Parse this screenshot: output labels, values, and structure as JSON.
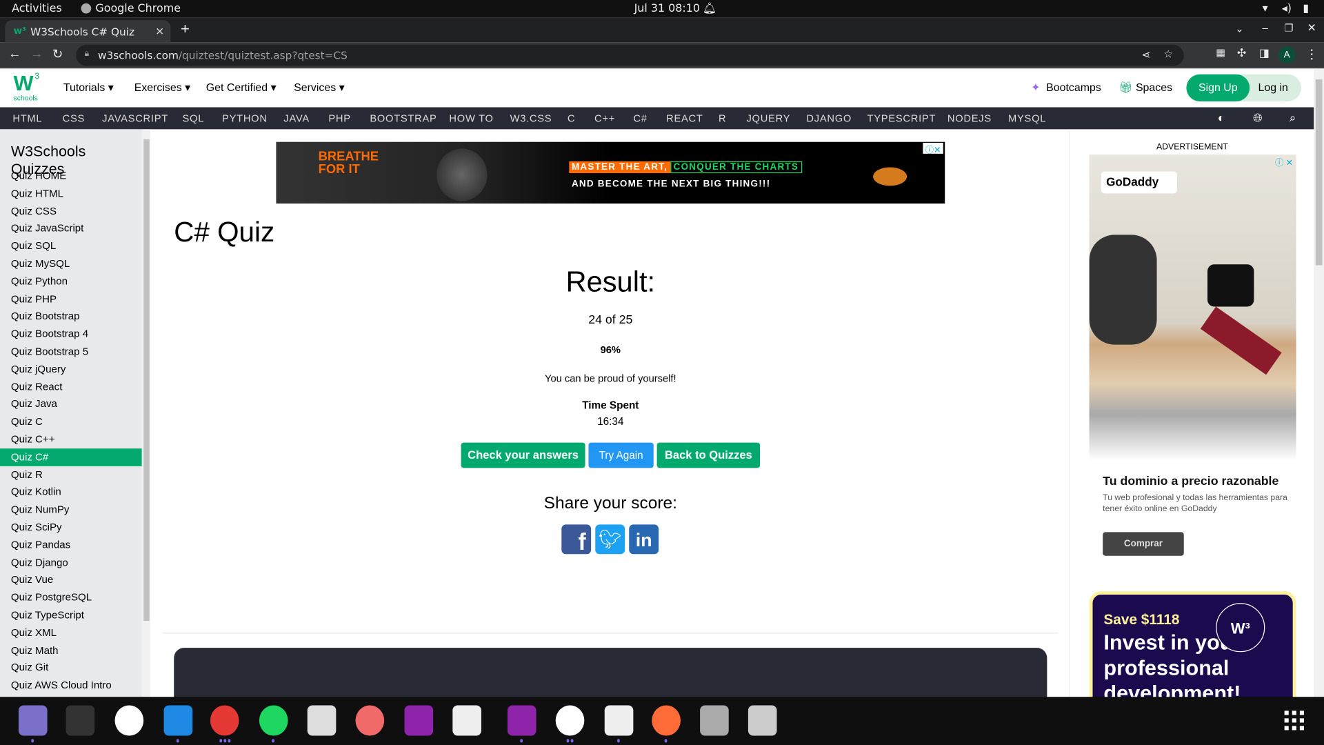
{
  "system": {
    "activities": "Activities",
    "app_name": "Google Chrome",
    "datetime": "Jul 31  08:10"
  },
  "browser": {
    "tab_title": "W3Schools C# Quiz",
    "url_domain": "w3schools.com",
    "url_path": "/quiztest/quiztest.asp?qtest=CS",
    "profile_initial": "A"
  },
  "header": {
    "logo_text": "schools",
    "menu": [
      "Tutorials",
      "Exercises",
      "Get Certified",
      "Services"
    ],
    "bootcamps": "Bootcamps",
    "spaces": "Spaces",
    "signup": "Sign Up",
    "login": "Log in"
  },
  "topnav": [
    "HTML",
    "CSS",
    "JAVASCRIPT",
    "SQL",
    "PYTHON",
    "JAVA",
    "PHP",
    "BOOTSTRAP",
    "HOW TO",
    "W3.CSS",
    "C",
    "C++",
    "C#",
    "REACT",
    "R",
    "JQUERY",
    "DJANGO",
    "TYPESCRIPT",
    "NODEJS",
    "MYSQL"
  ],
  "sidebar": {
    "title": "W3Schools Quizzes",
    "active": "Quiz C#",
    "items": [
      "Quiz HOME",
      "Quiz HTML",
      "Quiz CSS",
      "Quiz JavaScript",
      "Quiz SQL",
      "Quiz MySQL",
      "Quiz Python",
      "Quiz PHP",
      "Quiz Bootstrap",
      "Quiz Bootstrap 4",
      "Quiz Bootstrap 5",
      "Quiz jQuery",
      "Quiz React",
      "Quiz Java",
      "Quiz C",
      "Quiz C++",
      "Quiz C#",
      "Quiz R",
      "Quiz Kotlin",
      "Quiz NumPy",
      "Quiz SciPy",
      "Quiz Pandas",
      "Quiz Django",
      "Quiz Vue",
      "Quiz PostgreSQL",
      "Quiz TypeScript",
      "Quiz XML",
      "Quiz Math",
      "Quiz Git",
      "Quiz AWS Cloud Intro"
    ]
  },
  "banner_ad": {
    "left": "BREATHE FOR IT",
    "line1a": "MASTER THE ART,",
    "line1b": "CONQUER THE CHARTS",
    "line2": "AND BECOME THE NEXT BIG THING!!!"
  },
  "main": {
    "title": "C# Quiz",
    "result_heading": "Result:",
    "score": "24 of 25",
    "percent": "96%",
    "message": "You can be proud of yourself!",
    "time_label": "Time Spent",
    "time_value": "16:34",
    "buttons": {
      "check": "Check your answers",
      "retry": "Try Again",
      "back": "Back to Quizzes"
    },
    "share_heading": "Share your score:"
  },
  "right_ad": {
    "label": "ADVERTISEMENT",
    "brand": "GoDaddy",
    "headline": "Tu dominio a precio razonable",
    "body": "Tu web profesional y todas las herramientas para tener éxito online en GoDaddy",
    "cta": "Comprar",
    "promo_save": "Save $1118",
    "promo_text": "Invest in your professional development!"
  },
  "colors": {
    "brand_green": "#04AA6D",
    "topnav_bg": "#282A35",
    "try_again_blue": "#2196F3",
    "facebook": "#3b5998",
    "twitter": "#1da1f2",
    "linkedin": "#2867b2"
  }
}
